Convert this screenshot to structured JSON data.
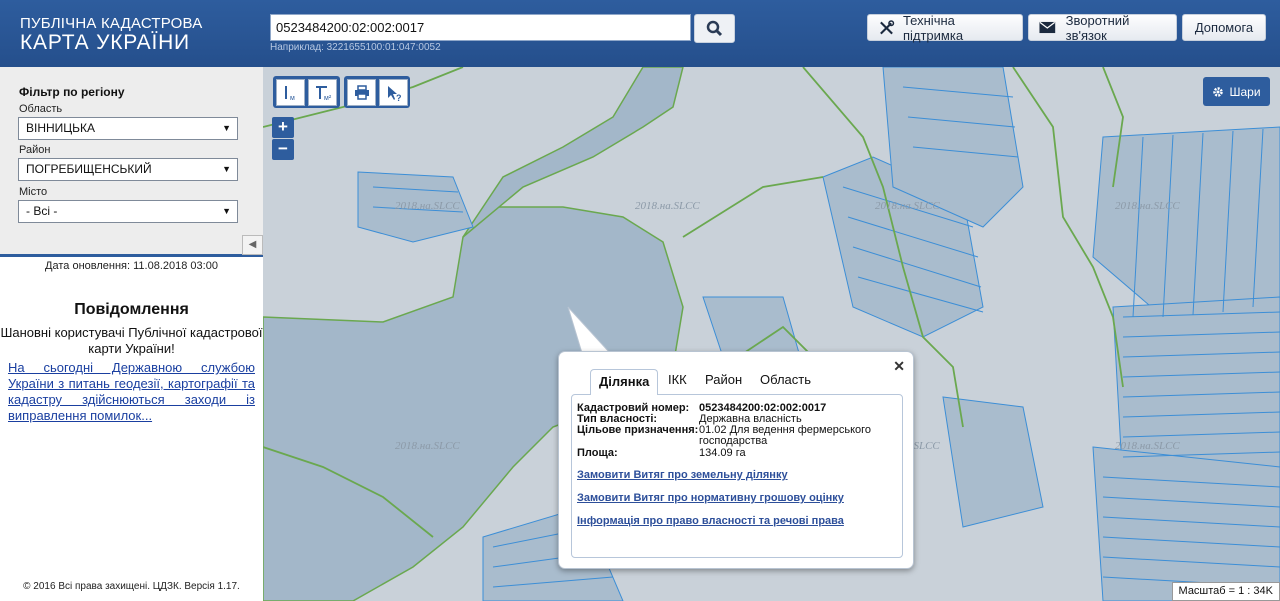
{
  "header": {
    "logo_line1": "ПУБЛІЧНА КАДАСТРОВА",
    "logo_line2": "КАРТА УКРАЇНИ",
    "search_value": "0523484200:02:002:0017",
    "search_hint": "Наприклад: 3221655100:01:047:0052",
    "support_label": "Технічна підтримка",
    "feedback_label": "Зворотний зв'язок",
    "help_label": "Допомога"
  },
  "filter": {
    "title": "Фільтр по регіону",
    "oblast_label": "Область",
    "oblast_value": "ВІННИЦЬКА",
    "rayon_label": "Район",
    "rayon_value": "ПОГРЕБИЩЕНСЬКИЙ",
    "city_label": "Місто",
    "city_value": "- Всі -",
    "collapse_icon": "◀"
  },
  "sidebar": {
    "update_date": "Дата оновлення: 11.08.2018 03:00",
    "notice_title": "Повідомлення",
    "notice_text": "Шановні користувачі Публічної кадастрової карти України!",
    "notice_link": "На сьогодні Державною службою України з питань геодезії, картографії та кадастру здійснюються заходи із виправлення помилок...",
    "copyright": "© 2016 Всі права захищені. ЦДЗК. Версія 1.17."
  },
  "map": {
    "zoom_in": "+",
    "zoom_out": "−",
    "layers_label": "Шари",
    "scale_text": "Масштаб = 1 : 34K",
    "watermark": "2018.на.SLCC",
    "colors": {
      "water": "#a3b7c9",
      "land": "#c9d1d9",
      "boundary": "#6aa84f",
      "parcel": "#3c8ed6"
    }
  },
  "popup": {
    "close_icon": "✕",
    "tabs": [
      "Ділянка",
      "ІКК",
      "Район",
      "Область"
    ],
    "fields": [
      {
        "label": "Кадастровий номер:",
        "value": "0523484200:02:002:0017"
      },
      {
        "label": "Тип власності:",
        "value": "Державна власність"
      },
      {
        "label": "Цільове призначення:",
        "value": "01.02 Для ведення фермерського господарства"
      },
      {
        "label": "Площа:",
        "value": "134.09 га"
      }
    ],
    "links": [
      "Замовити Витяг про земельну ділянку",
      "Замовити Витяг про нормативну грошову оцінку",
      "Інформація про право власності та речові права"
    ]
  }
}
